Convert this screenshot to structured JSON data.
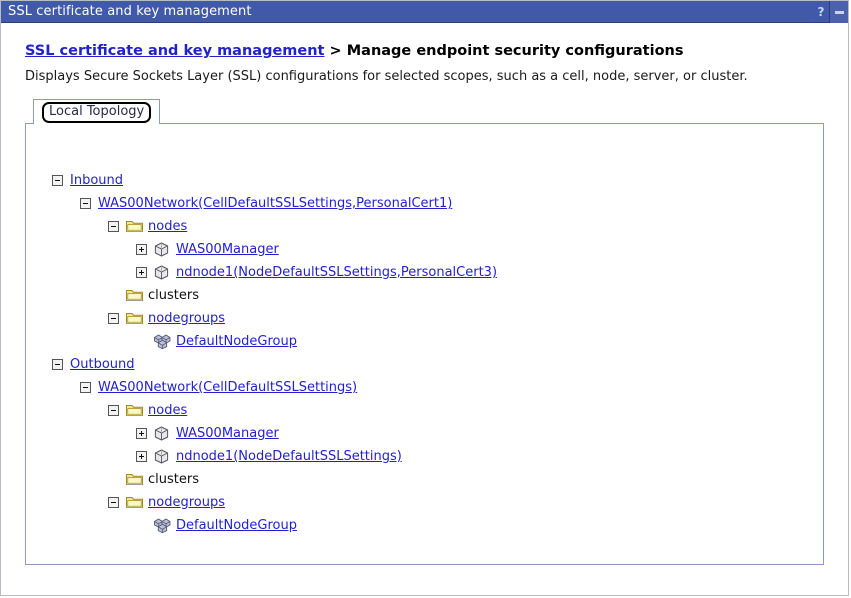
{
  "window": {
    "title": "SSL certificate and key management",
    "help_button": "?",
    "minimize_button": "–",
    "title_bg": "#4059a8",
    "title_fg": "#ffffff"
  },
  "breadcrumb": {
    "link": "SSL certificate and key management",
    "separator": ">",
    "current": "Manage endpoint security configurations"
  },
  "description": "Displays Secure Sockets Layer (SSL) configurations for selected scopes, such as a cell, node, server, or cluster.",
  "tabs": [
    {
      "label": "Local Topology",
      "selected": true
    }
  ],
  "colors": {
    "link": "#2222cc",
    "panel_border": "#8a9bbd",
    "folder_fill": "#f3e88a",
    "folder_edge": "#a08a24",
    "node_fill": "#e8e8ec",
    "node_edge": "#55555e",
    "nodegroup_fill": "#b9bfd6",
    "nodegroup_edge": "#4a4f66"
  },
  "tree": [
    {
      "level": 0,
      "state": "expanded",
      "icon": "none",
      "label": "Inbound",
      "link": true
    },
    {
      "level": 1,
      "state": "expanded",
      "icon": "none",
      "label": "WAS00Network(CellDefaultSSLSettings,PersonalCert1)",
      "link": true
    },
    {
      "level": 2,
      "state": "expanded",
      "icon": "folder",
      "label": "nodes",
      "link": true
    },
    {
      "level": 3,
      "state": "collapsed",
      "icon": "node",
      "label": "WAS00Manager",
      "link": true
    },
    {
      "level": 3,
      "state": "collapsed",
      "icon": "node",
      "label": "ndnode1(NodeDefaultSSLSettings,PersonalCert3)",
      "link": true
    },
    {
      "level": 2,
      "state": "leaf",
      "icon": "folder",
      "label": "clusters",
      "link": false
    },
    {
      "level": 2,
      "state": "expanded",
      "icon": "folder",
      "label": "nodegroups",
      "link": true
    },
    {
      "level": 3,
      "state": "leaf",
      "icon": "nodegroup",
      "label": "DefaultNodeGroup",
      "link": true
    },
    {
      "level": 0,
      "state": "expanded",
      "icon": "none",
      "label": "Outbound",
      "link": true
    },
    {
      "level": 1,
      "state": "expanded",
      "icon": "none",
      "label": "WAS00Network(CellDefaultSSLSettings)",
      "link": true
    },
    {
      "level": 2,
      "state": "expanded",
      "icon": "folder",
      "label": "nodes",
      "link": true
    },
    {
      "level": 3,
      "state": "collapsed",
      "icon": "node",
      "label": "WAS00Manager",
      "link": true
    },
    {
      "level": 3,
      "state": "collapsed",
      "icon": "node",
      "label": "ndnode1(NodeDefaultSSLSettings)",
      "link": true
    },
    {
      "level": 2,
      "state": "leaf",
      "icon": "folder",
      "label": "clusters",
      "link": false
    },
    {
      "level": 2,
      "state": "expanded",
      "icon": "folder",
      "label": "nodegroups",
      "link": true
    },
    {
      "level": 3,
      "state": "leaf",
      "icon": "nodegroup",
      "label": "DefaultNodeGroup",
      "link": true
    }
  ]
}
